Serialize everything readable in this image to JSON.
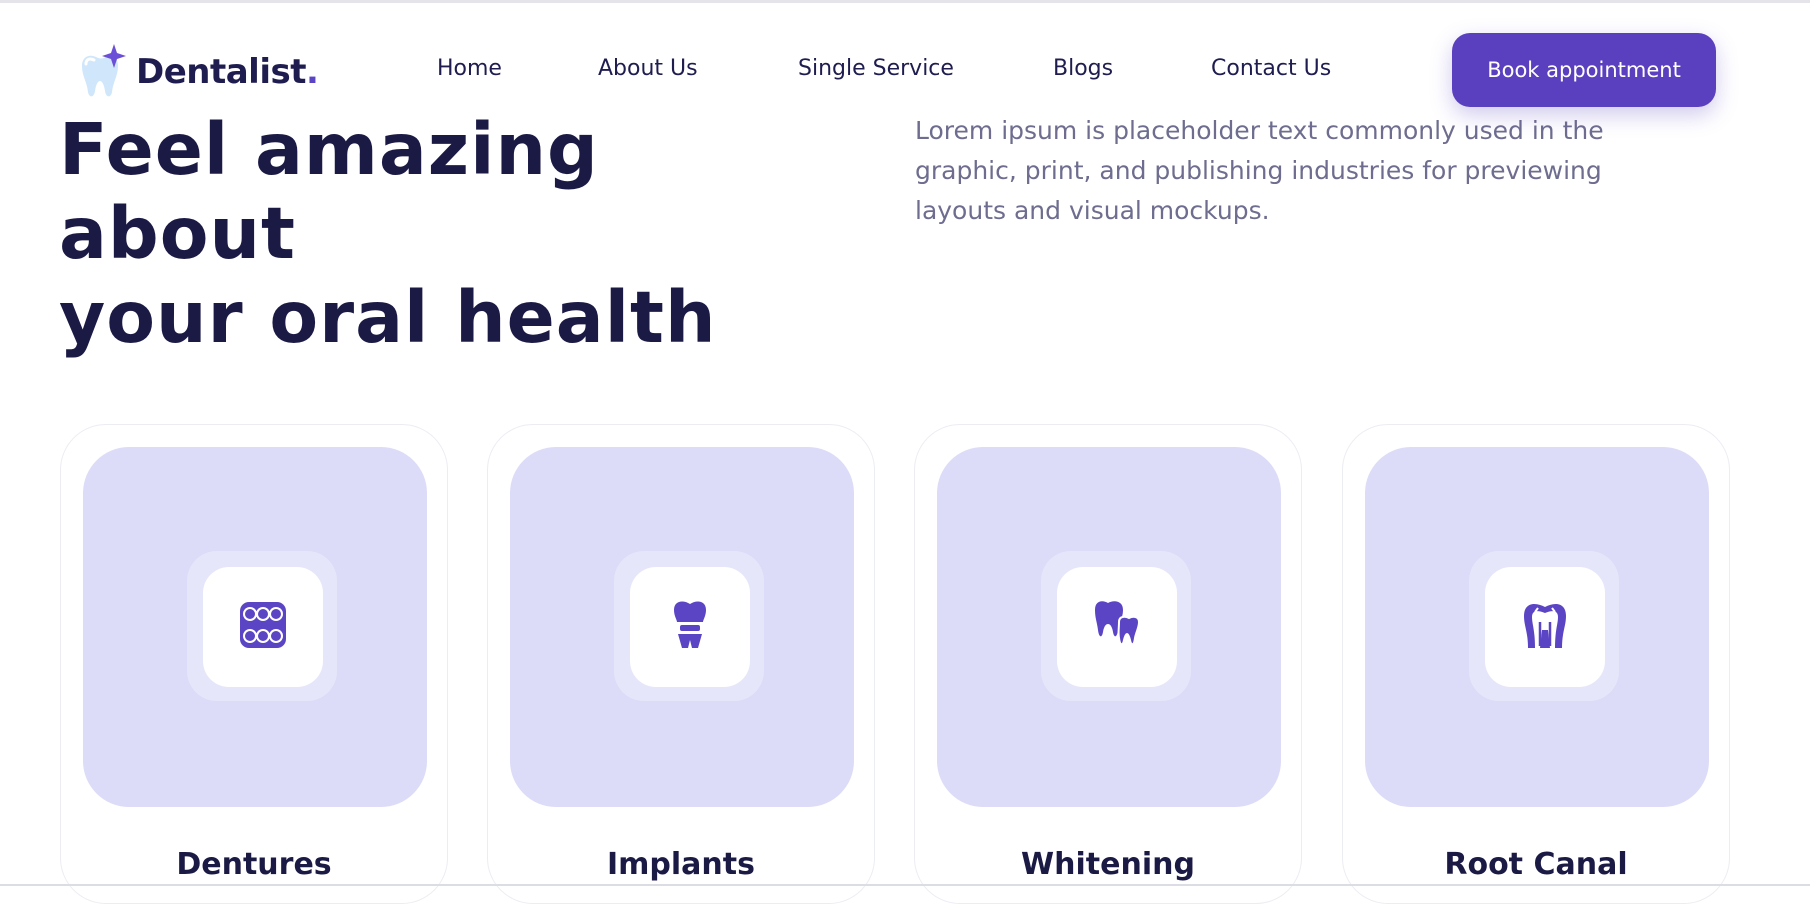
{
  "brand": {
    "name": "Dentalist",
    "dot": "."
  },
  "nav": {
    "items": [
      "Home",
      "About Us",
      "Single Service",
      "Blogs",
      "Contact Us"
    ],
    "cta_label": "Book appointment"
  },
  "hero": {
    "title": "Feel amazing about\nyour oral health",
    "description": "Lorem ipsum is placeholder text commonly used in the graphic, print, and publishing industries for previewing layouts and visual mockups."
  },
  "services": [
    {
      "title": "Dentures",
      "icon": "dentures-icon"
    },
    {
      "title": "Implants",
      "icon": "dental-crown-icon"
    },
    {
      "title": "Whitening",
      "icon": "teeth-icon"
    },
    {
      "title": "Root Canal",
      "icon": "root-canal-icon"
    }
  ],
  "colors": {
    "primary": "#5a40bf",
    "heading": "#1b1a45",
    "body_text": "#6e6d8f",
    "card_media_bg": "#dcdcf8",
    "icon": "#5b45c4"
  }
}
